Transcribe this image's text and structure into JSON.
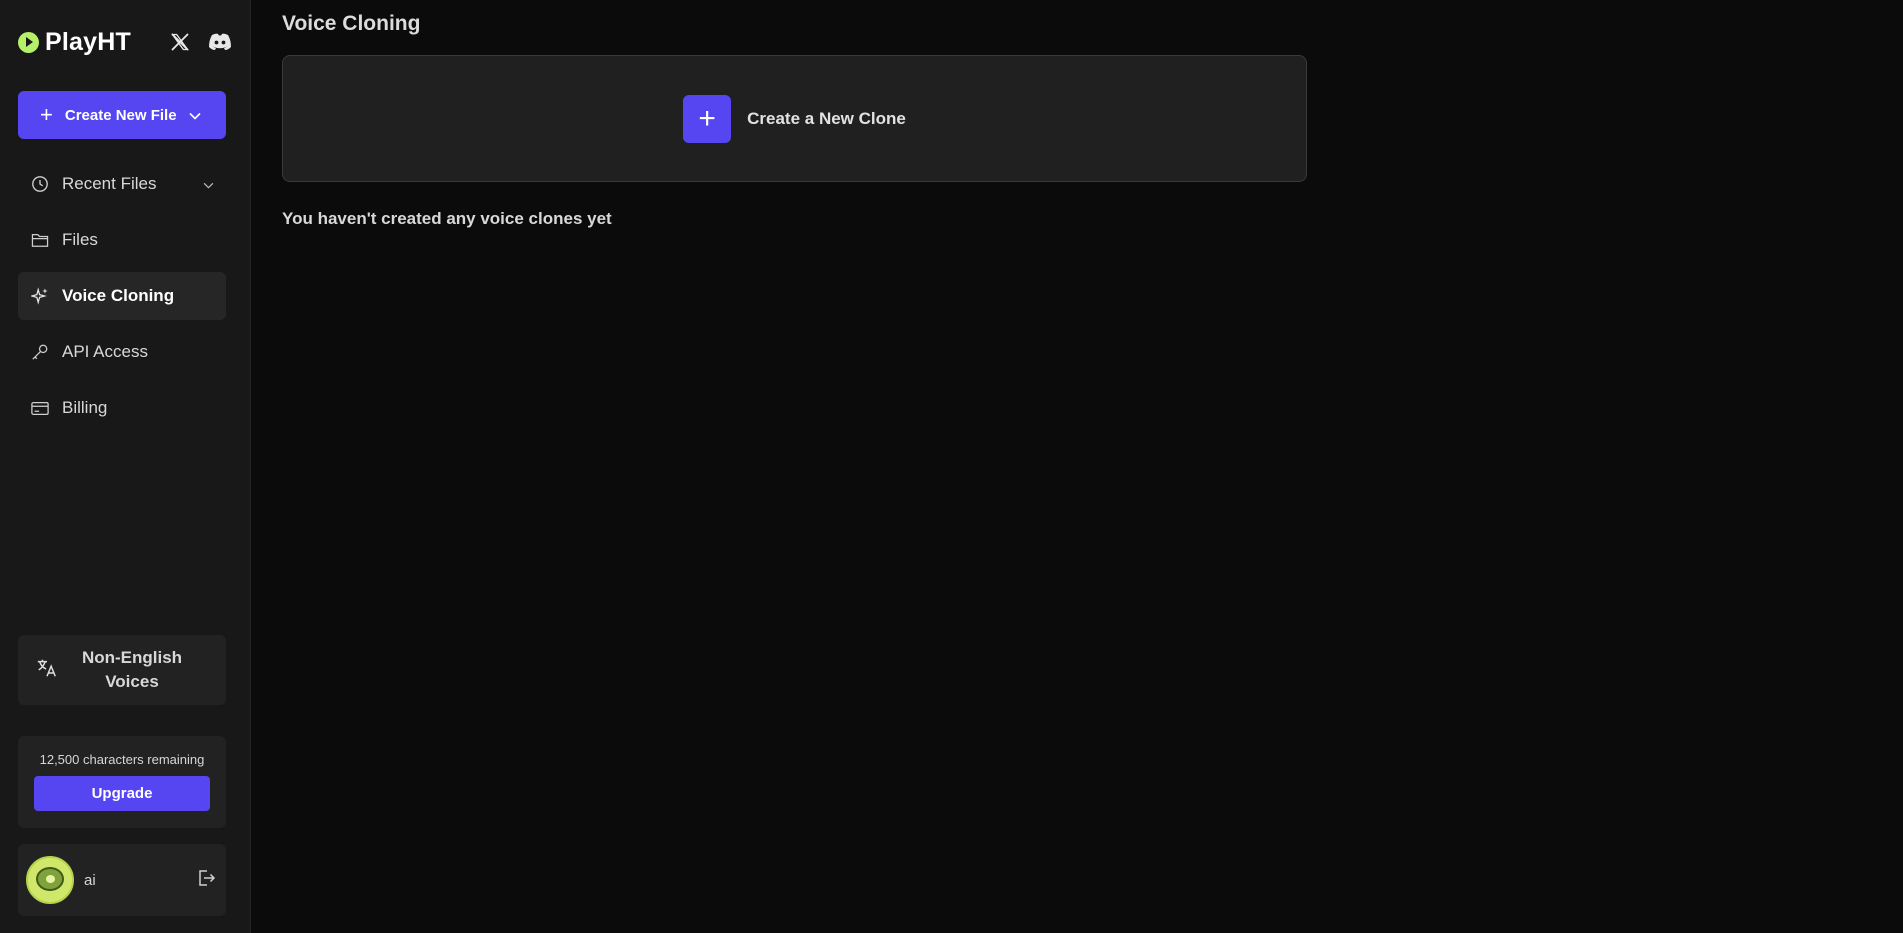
{
  "brand": {
    "name": "PlayHT",
    "color": "#b6f06a"
  },
  "social": {
    "x_icon": "x-twitter-icon",
    "discord_icon": "discord-icon"
  },
  "sidebar": {
    "create_button": {
      "label": "Create New File"
    },
    "items": [
      {
        "label": "Recent Files",
        "icon": "clock-icon",
        "expandable": true
      },
      {
        "label": "Files",
        "icon": "folder-icon"
      },
      {
        "label": "Voice Cloning",
        "icon": "sparkles-icon",
        "active": true
      },
      {
        "label": "API Access",
        "icon": "key-icon"
      },
      {
        "label": "Billing",
        "icon": "credit-card-icon"
      }
    ],
    "non_english": {
      "label": "Non-English Voices",
      "icon": "translate-icon"
    },
    "usage": {
      "remaining": "12,500 characters remaining",
      "upgrade_label": "Upgrade"
    },
    "user": {
      "name": "ai"
    }
  },
  "main": {
    "title": "Voice Cloning",
    "create_clone_label": "Create a New Clone",
    "empty_message": "You haven't created any voice clones yet"
  },
  "colors": {
    "accent": "#5546f2",
    "background": "#0b0b0b",
    "sidebar": "#181818"
  }
}
